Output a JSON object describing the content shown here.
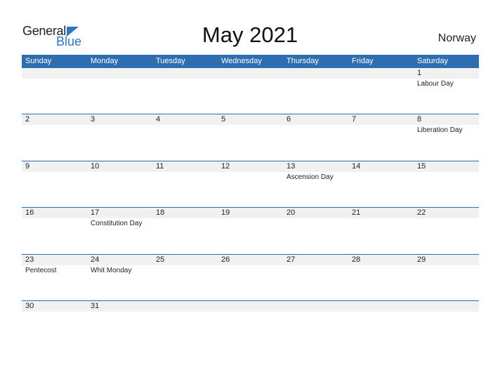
{
  "logo": {
    "general": "General",
    "blue": "Blue",
    "icon": "triangle-flag-icon"
  },
  "title": "May 2021",
  "country": "Norway",
  "colors": {
    "header": "#2E6DB0",
    "band": "#F1F1F1",
    "logo_blue": "#2E74C2"
  },
  "weekdays": [
    "Sunday",
    "Monday",
    "Tuesday",
    "Wednesday",
    "Thursday",
    "Friday",
    "Saturday"
  ],
  "weeks": [
    [
      {
        "d": ""
      },
      {
        "d": ""
      },
      {
        "d": ""
      },
      {
        "d": ""
      },
      {
        "d": ""
      },
      {
        "d": ""
      },
      {
        "d": "1",
        "h": "Labour Day"
      }
    ],
    [
      {
        "d": "2"
      },
      {
        "d": "3"
      },
      {
        "d": "4"
      },
      {
        "d": "5"
      },
      {
        "d": "6"
      },
      {
        "d": "7"
      },
      {
        "d": "8",
        "h": "Liberation Day"
      }
    ],
    [
      {
        "d": "9"
      },
      {
        "d": "10"
      },
      {
        "d": "11"
      },
      {
        "d": "12"
      },
      {
        "d": "13",
        "h": "Ascension Day"
      },
      {
        "d": "14"
      },
      {
        "d": "15"
      }
    ],
    [
      {
        "d": "16"
      },
      {
        "d": "17",
        "h": "Constitution Day"
      },
      {
        "d": "18"
      },
      {
        "d": "19"
      },
      {
        "d": "20"
      },
      {
        "d": "21"
      },
      {
        "d": "22"
      }
    ],
    [
      {
        "d": "23",
        "h": "Pentecost"
      },
      {
        "d": "24",
        "h": "Whit Monday"
      },
      {
        "d": "25"
      },
      {
        "d": "26"
      },
      {
        "d": "27"
      },
      {
        "d": "28"
      },
      {
        "d": "29"
      }
    ],
    [
      {
        "d": "30"
      },
      {
        "d": "31"
      },
      {
        "d": ""
      },
      {
        "d": ""
      },
      {
        "d": ""
      },
      {
        "d": ""
      },
      {
        "d": ""
      }
    ]
  ]
}
